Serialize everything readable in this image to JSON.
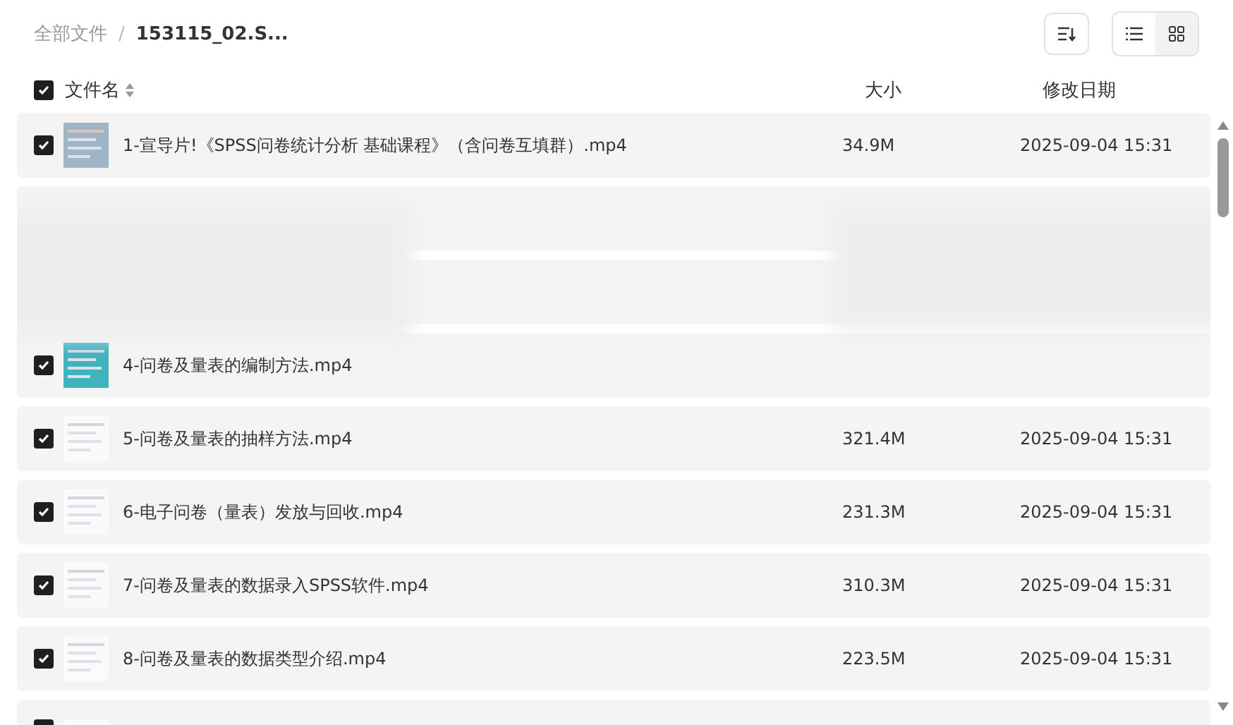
{
  "breadcrumb": [
    {
      "label": "全部文件",
      "current": false
    },
    {
      "label": "153115_02.S...",
      "current": true
    }
  ],
  "breadcrumb_separator": "/",
  "view_toggle": [
    {
      "kind": "list",
      "selected": true
    },
    {
      "kind": "grid",
      "selected": false
    }
  ],
  "header": {
    "checked": true,
    "columns": [
      "文件名",
      "大小",
      "修改日期"
    ]
  },
  "rows": [
    {
      "kind": "file",
      "checked": true,
      "name": "1-宣导片!《SPSS问卷统计分析 基础课程》（含问卷互填群）.mp4",
      "size": "34.9M",
      "date": "2025-09-04 15:31"
    },
    {
      "kind": "obscured"
    },
    {
      "kind": "obscured"
    },
    {
      "kind": "file",
      "checked": true,
      "name": "4-问卷及量表的编制方法.mp4"
    },
    {
      "kind": "file",
      "checked": true,
      "name": "5-问卷及量表的抽样方法.mp4",
      "size": "321.4M",
      "date": "2025-09-04 15:31"
    },
    {
      "kind": "file",
      "checked": true,
      "name": "6-电子问卷（量表）发放与回收.mp4",
      "size": "231.3M",
      "date": "2025-09-04 15:31"
    },
    {
      "kind": "file",
      "checked": true,
      "name": "7-问卷及量表的数据录入SPSS软件.mp4",
      "size": "310.3M",
      "date": "2025-09-04 15:31"
    },
    {
      "kind": "file",
      "checked": true,
      "name": "8-问卷及量表的数据类型介绍.mp4",
      "size": "223.5M",
      "date": "2025-09-04 15:31"
    },
    {
      "kind": "partial",
      "checked": true
    }
  ]
}
